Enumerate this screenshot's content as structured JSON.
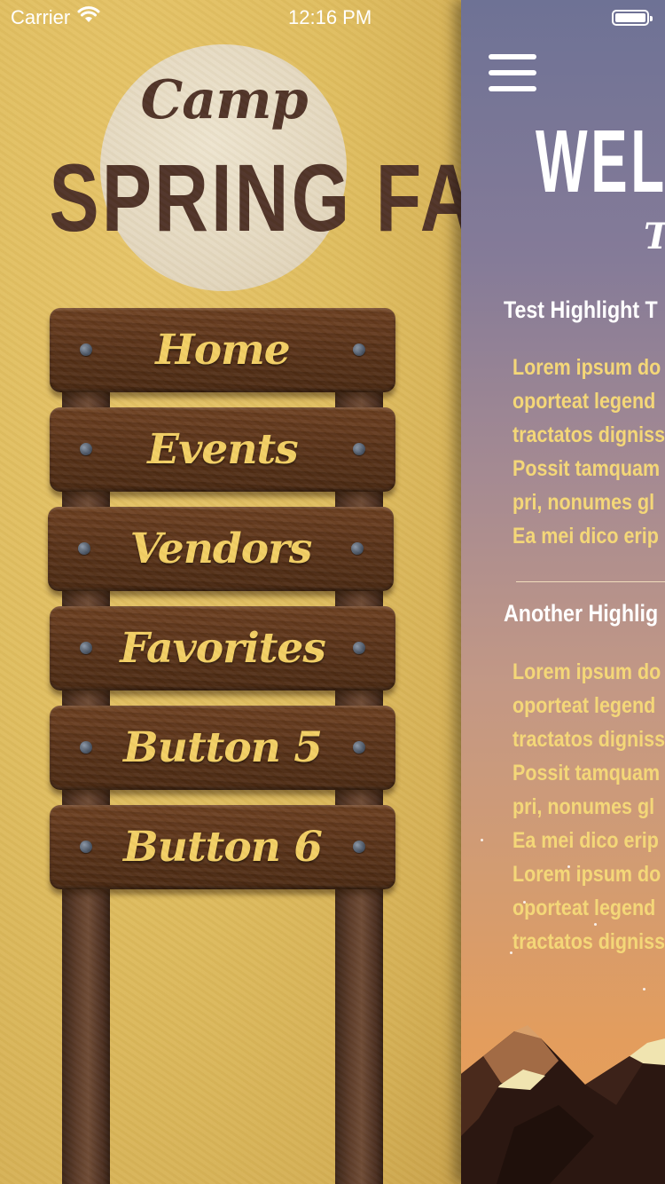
{
  "status_bar": {
    "carrier": "Carrier",
    "time": "12:16 PM"
  },
  "logo": {
    "camp": "Camp",
    "title": "SPRING FAIR"
  },
  "menu": {
    "items": [
      {
        "label": "Home"
      },
      {
        "label": "Events"
      },
      {
        "label": "Vendors"
      },
      {
        "label": "Favorites"
      },
      {
        "label": "Button 5"
      },
      {
        "label": "Button 6"
      }
    ]
  },
  "content": {
    "welcome": "WELC",
    "welcome_sub": "T",
    "highlights": [
      {
        "title": "Test Highlight T",
        "lines": [
          "Lorem ipsum do",
          "oporteat legend",
          "tractatos digniss",
          "Possit tamquam",
          "pri, nonumes gl",
          "Ea mei dico erip"
        ]
      },
      {
        "title": "Another Highlig",
        "lines": [
          "Lorem ipsum do",
          "oporteat legend",
          "tractatos digniss",
          "Possit tamquam",
          "pri, nonumes gl",
          "Ea mei dico erip",
          "Lorem ipsum do",
          "oporteat legend",
          "tractatos digniss"
        ]
      }
    ]
  },
  "colors": {
    "sign_text": "#f2cf64",
    "logo_text": "#4e3227",
    "body_text": "#f4d778"
  }
}
